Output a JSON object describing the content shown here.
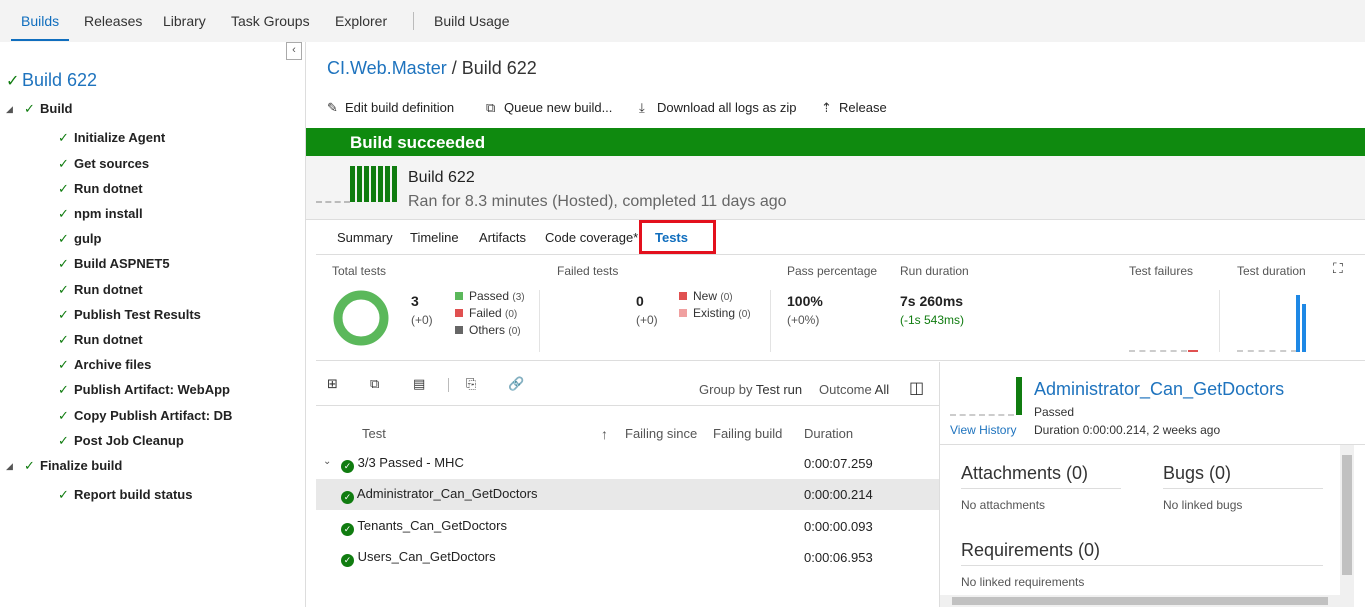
{
  "topnav": {
    "tabs": [
      "Builds",
      "Releases",
      "Library",
      "Task Groups",
      "Explorer",
      "Build Usage"
    ],
    "active": "Builds"
  },
  "leftpane": {
    "collapse_glyph": "‹",
    "root": "Build 622",
    "phases": [
      {
        "label": "Build",
        "steps": [
          "Initialize Agent",
          "Get sources",
          "Run dotnet",
          "npm install",
          "gulp",
          "Build ASPNET5",
          "Run dotnet",
          "Publish Test Results",
          "Run dotnet",
          "Archive files",
          "Publish Artifact: WebApp",
          "Copy Publish Artifact: DB",
          "Post Job Cleanup"
        ]
      },
      {
        "label": "Finalize build",
        "steps": [
          "Report build status"
        ]
      }
    ]
  },
  "header": {
    "breadcrumb_link": "CI.Web.Master",
    "breadcrumb_sep": " / ",
    "breadcrumb_current": "Build 622"
  },
  "toolbar": {
    "edit": "Edit build definition",
    "queue": "Queue new build...",
    "download": "Download all logs as zip",
    "release": "Release"
  },
  "banner": {
    "status": "Build succeeded",
    "color": "#0f8a0f"
  },
  "build": {
    "name": "Build 622",
    "info": "Ran for 8.3 minutes (Hosted), completed 11 days ago"
  },
  "subtabs": [
    "Summary",
    "Timeline",
    "Artifacts",
    "Code coverage*",
    "Tests"
  ],
  "subtabs_active": "Tests",
  "metrics": {
    "total_tests_label": "Total tests",
    "total": "3",
    "total_delta": "(+0)",
    "legend": [
      {
        "label": "Passed",
        "count": "(3)",
        "color": "#5bb85b"
      },
      {
        "label": "Failed",
        "count": "(0)",
        "color": "#e05050"
      },
      {
        "label": "Others",
        "count": "(0)",
        "color": "#666666"
      }
    ],
    "failed_tests_label": "Failed tests",
    "failed": "0",
    "failed_delta": "(+0)",
    "failed_legend": [
      {
        "label": "New",
        "count": "(0)",
        "color": "#e05050"
      },
      {
        "label": "Existing",
        "count": "(0)",
        "color": "#f0a0a0"
      }
    ],
    "pass_pct_label": "Pass percentage",
    "pass_pct": "100%",
    "pass_pct_delta": "(+0%)",
    "run_duration_label": "Run duration",
    "run_duration": "7s 260ms",
    "run_duration_delta": "(-1s 543ms)",
    "test_failures_label": "Test failures",
    "test_duration_label": "Test duration"
  },
  "grid": {
    "group_by_label": "Group by",
    "group_by_value": "Test run",
    "outcome_label": "Outcome",
    "outcome_value": "All",
    "columns": [
      "Test",
      "Failing since",
      "Failing build",
      "Duration"
    ],
    "group": {
      "label": "3/3 Passed - MHC",
      "duration": "0:00:07.259"
    },
    "rows": [
      {
        "name": "Administrator_Can_GetDoctors",
        "duration": "0:00:00.214"
      },
      {
        "name": "Tenants_Can_GetDoctors",
        "duration": "0:00:00.093"
      },
      {
        "name": "Users_Can_GetDoctors",
        "duration": "0:00:06.953"
      }
    ]
  },
  "detail": {
    "title": "Administrator_Can_GetDoctors",
    "outcome": "Passed",
    "view_history": "View History",
    "duration": "Duration 0:00:00.214, 2 weeks ago",
    "attachments_title": "Attachments (0)",
    "attachments_empty": "No attachments",
    "bugs_title": "Bugs (0)",
    "bugs_empty": "No linked bugs",
    "requirements_title": "Requirements (0)",
    "requirements_empty": "No linked requirements"
  }
}
